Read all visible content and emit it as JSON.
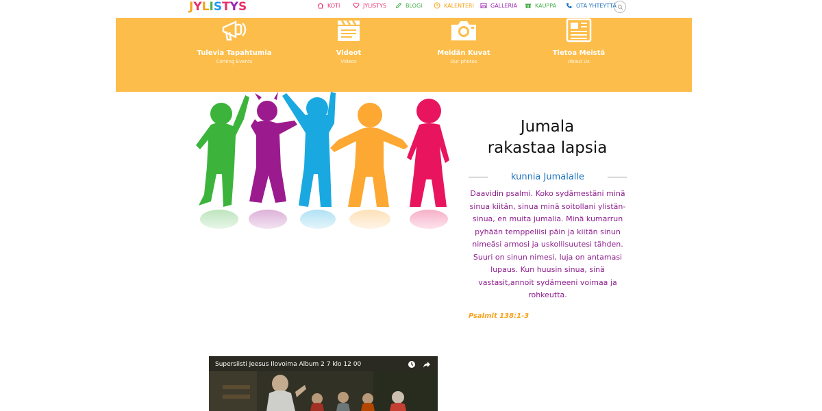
{
  "logo": {
    "letters": [
      "J",
      "Y",
      "L",
      "I",
      "S",
      "T",
      "Y",
      "S"
    ],
    "colors": [
      "#f7a21b",
      "#e8306a",
      "#f7a21b",
      "#4caf50",
      "#2196f3",
      "#e8306a",
      "#9c27b0",
      "#e8306a"
    ]
  },
  "nav": {
    "items": [
      {
        "label": "KOTI",
        "icon": "home-icon",
        "color": "#e8306a"
      },
      {
        "label": "JYLISTYS",
        "icon": "heart-icon",
        "color": "#e8306a"
      },
      {
        "label": "BLOGI",
        "icon": "pencil-icon",
        "color": "#4caf50"
      },
      {
        "label": "KALENTERI",
        "icon": "calendar-icon",
        "color": "#f7a21b"
      },
      {
        "label": "GALLERIA",
        "icon": "picture-icon",
        "color": "#9c27b0"
      },
      {
        "label": "KAUPPA",
        "icon": "gift-icon",
        "color": "#4caf50"
      },
      {
        "label": "OTA YHTEYTTÄ",
        "icon": "phone-icon",
        "color": "#1e73be"
      }
    ]
  },
  "features": [
    {
      "title": "Tulevia Tapahtumia",
      "subtitle": "Coming Events",
      "icon": "megaphone-icon"
    },
    {
      "title": "Videot",
      "subtitle": "Videos",
      "icon": "clapperboard-icon"
    },
    {
      "title": "Meidän Kuvat",
      "subtitle": "Our photos",
      "icon": "camera-icon"
    },
    {
      "title": "Tietoa Meistä",
      "subtitle": "About Us",
      "icon": "newspaper-icon"
    }
  ],
  "main": {
    "headline_line1": "Jumala",
    "headline_line2": "rakastaa lapsia",
    "subheading": "kunnia Jumalalle",
    "psalm_lines": [
      "Daavidin psalmi. Koko sydämestäni minä",
      "sinua kiitän, sinua minä soitollani ylistän-",
      "sinua, en muita jumalia. Minä kumarrun",
      "pyhään temppeliisi päin ja kiitän sinun",
      "nimeäsi armosi ja uskollisuutesi tähden.",
      "Suuri on sinun nimesi, luja on antamasi",
      "lupaus. Kun huusin sinua, sinä",
      "vastasit,annoit sydämeeni voimaa ja",
      "rohkeutta."
    ],
    "reference": "Psalmit 138:1-3"
  },
  "video": {
    "title": "Supersiisti Jeesus Ilovoima Album 2 7 klo 12 00"
  },
  "colors": {
    "band": "#fdbd4a",
    "accent_blue": "#1e73be",
    "psalm_purple": "#8e1d8e",
    "ref_orange": "#f7a21b"
  }
}
